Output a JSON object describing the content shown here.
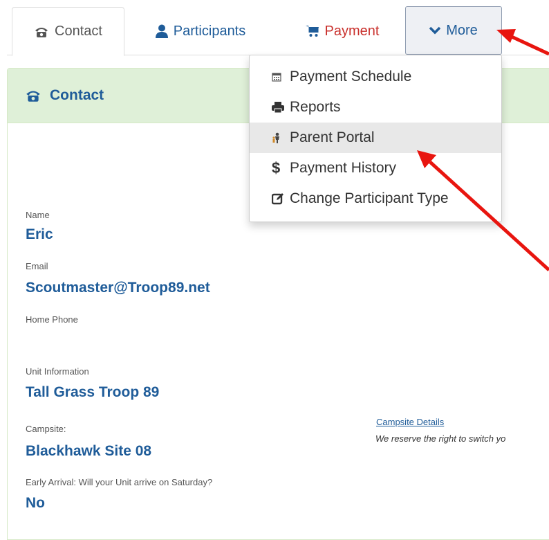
{
  "tabs": [
    {
      "label": "Contact",
      "icon": "phone-icon"
    },
    {
      "label": "Participants",
      "icon": "user-icon"
    },
    {
      "label": "Payment",
      "icon": "cart-icon"
    },
    {
      "label": "More",
      "icon": "chevron-down-icon"
    }
  ],
  "panel": {
    "title": "Contact",
    "icon": "phone-icon"
  },
  "fields": {
    "name_label": "Name",
    "name_value": "Eric",
    "email_label": "Email",
    "email_value": "Scoutmaster@Troop89.net",
    "phone_label": "Home Phone",
    "unit_label": "Unit Information",
    "unit_value": "Tall Grass Troop 89",
    "campsite_label": "Campsite:",
    "campsite_value": "Blackhawk Site 08",
    "early_label": "Early Arrival: Will your Unit arrive on Saturday?",
    "early_value": "No"
  },
  "campsite_details": {
    "link": "Campsite Details",
    "note": "We reserve the right to switch yo"
  },
  "dropdown": {
    "items": [
      {
        "label": "Payment Schedule",
        "icon": "calendar-icon"
      },
      {
        "label": "Reports",
        "icon": "print-icon"
      },
      {
        "label": "Parent Portal",
        "icon": "parent-child-icon"
      },
      {
        "label": "Payment History",
        "icon": "dollar-icon"
      },
      {
        "label": "Change Participant Type",
        "icon": "edit-icon"
      }
    ]
  },
  "colors": {
    "accent": "#1f5c99",
    "payment": "#c9302c",
    "panel_header": "#dff0d8",
    "annotation_arrow": "#e8150f"
  }
}
